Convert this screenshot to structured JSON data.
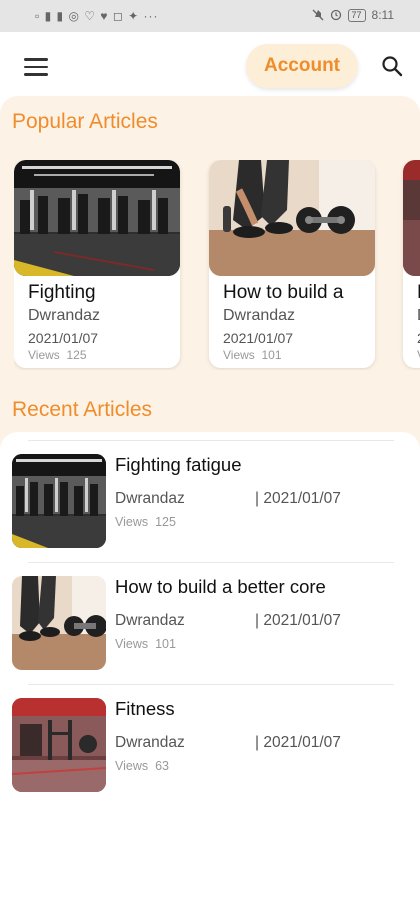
{
  "statusbar": {
    "left_icons": "▫︎ ▮ ▮ ◎ ♡ ♥ ◻ ✦ ···",
    "icons": [
      "mute-icon",
      "alarm-icon",
      "battery-icon"
    ],
    "battery": "77",
    "time": "8:11"
  },
  "header": {
    "menu_icon": "hamburger-menu-icon",
    "account_label": "Account",
    "search_icon": "search-icon"
  },
  "colors": {
    "accent": "#ef8d2c",
    "account_bg": "#fdeed8",
    "section_bg": "#fdf2e6"
  },
  "popular": {
    "title": "Popular Articles",
    "cards": [
      {
        "title": "Fighting",
        "author": "Dwrandaz",
        "date": "2021/01/07",
        "views_label": "Views",
        "views": "125",
        "image": "gym-interior"
      },
      {
        "title": "How to build a",
        "author": "Dwrandaz",
        "date": "2021/01/07",
        "views_label": "Views",
        "views": "101",
        "image": "dumbbell-workout"
      },
      {
        "title": "F",
        "author": "D",
        "date": "2",
        "views_label": "V",
        "views": "",
        "image": "red-gym"
      }
    ]
  },
  "recent": {
    "title": "Recent Articles",
    "items": [
      {
        "title": "Fighting fatigue",
        "author": "Dwrandaz",
        "date": "| 2021/01/07",
        "views_label": "Views",
        "views": "125",
        "image": "gym-interior"
      },
      {
        "title": "How to build a better core",
        "author": "Dwrandaz",
        "date": "| 2021/01/07",
        "views_label": "Views",
        "views": "101",
        "image": "dumbbell-workout"
      },
      {
        "title": "Fitness",
        "author": "Dwrandaz",
        "date": "| 2021/01/07",
        "views_label": "Views",
        "views": "63",
        "image": "red-gym"
      }
    ]
  }
}
